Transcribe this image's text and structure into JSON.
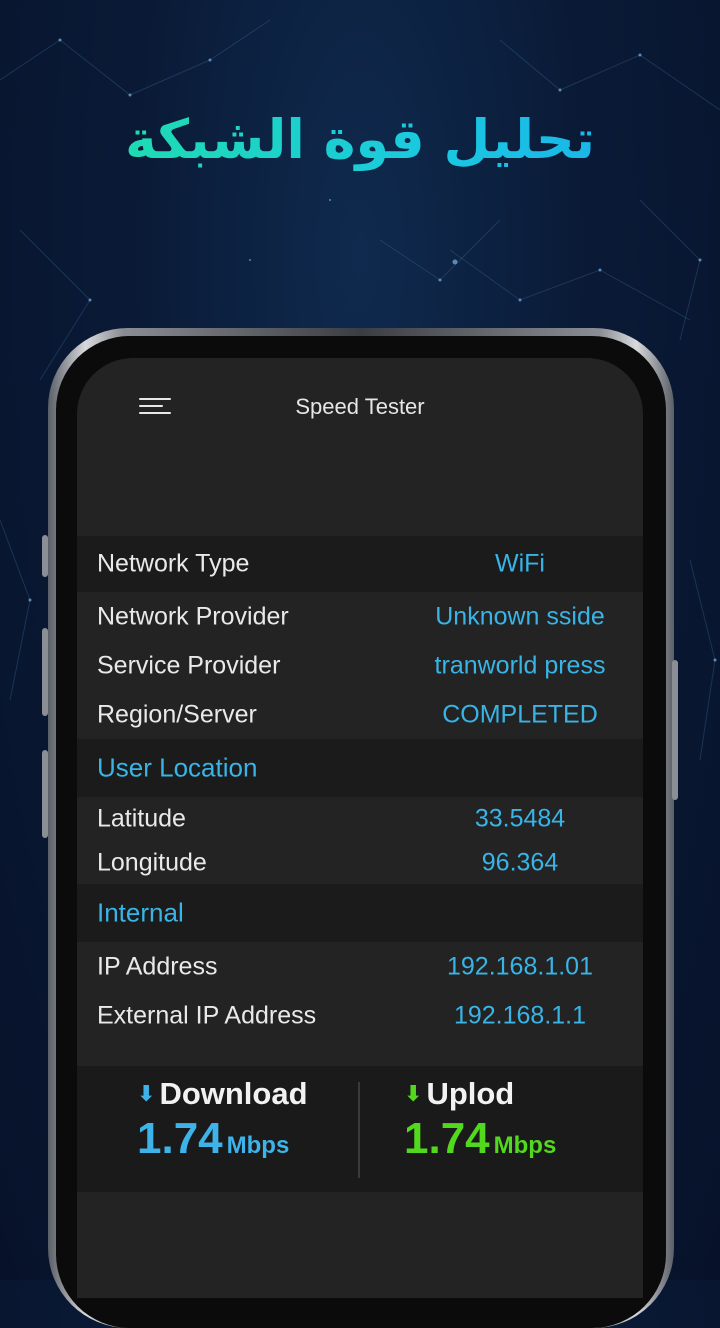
{
  "headline": "تحليل قوة الشبكة",
  "app": {
    "title": "Speed Tester",
    "menu_icon": "hamburger-menu-icon"
  },
  "network": {
    "type_label": "Network Type",
    "type_value": "WiFi",
    "provider_label": "Network Provider",
    "provider_value": "Unknown sside",
    "service_label": "Service Provider",
    "service_value": "tranworld press",
    "region_label": "Region/Server",
    "region_value": "COMPLETED"
  },
  "location": {
    "section_title": "User Location",
    "lat_label": "Latitude",
    "lat_value": "33.5484",
    "lon_label": "Longitude",
    "lon_value": "96.364"
  },
  "internal": {
    "section_title": "Internal",
    "ip_label": "IP Address",
    "ip_value": "192.168.1.01",
    "ext_ip_label": "External IP Address",
    "ext_ip_value": "192.168.1.1"
  },
  "speed": {
    "download_label": "Download",
    "download_value": "1.74",
    "download_unit": "Mbps",
    "upload_label": "Uplod",
    "upload_value": "1.74",
    "upload_unit": "Mbps"
  },
  "colors": {
    "accent_blue": "#38b4e6",
    "accent_green": "#52d91d",
    "screen_bg": "#232324"
  }
}
